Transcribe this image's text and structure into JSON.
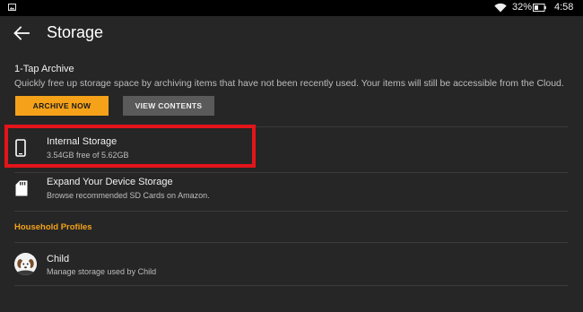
{
  "status_bar": {
    "notification_icon": "image-notification-icon",
    "wifi_icon": "wifi-icon",
    "battery_percent": "32%",
    "battery_icon": "battery-icon",
    "time": "4:58"
  },
  "header": {
    "back_icon": "back-arrow-icon",
    "title": "Storage"
  },
  "archive": {
    "title": "1-Tap Archive",
    "description": "Quickly free up storage space by archiving items that have not been recently used. Your items will still be accessible from the Cloud.",
    "archive_button": "ARCHIVE NOW",
    "view_button": "VIEW CONTENTS"
  },
  "storage_items": [
    {
      "icon": "phone-icon",
      "title": "Internal Storage",
      "subtitle": "3.54GB free of 5.62GB"
    },
    {
      "icon": "sd-card-icon",
      "title": "Expand Your Device Storage",
      "subtitle": "Browse recommended SD Cards on Amazon."
    }
  ],
  "household": {
    "header": "Household Profiles",
    "profiles": [
      {
        "icon": "child-avatar",
        "name": "Child",
        "subtitle": "Manage storage used by Child"
      }
    ]
  },
  "colors": {
    "accent": "#f5a21a",
    "highlight": "#e3141a",
    "background": "#262626"
  }
}
